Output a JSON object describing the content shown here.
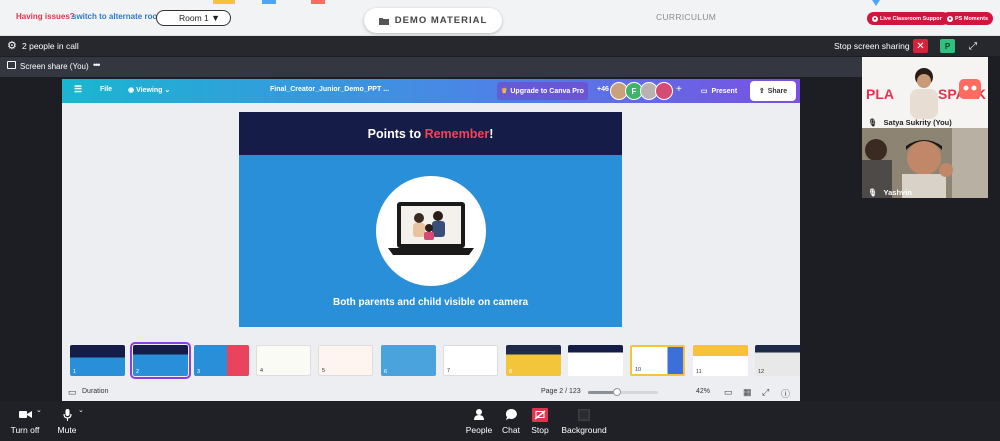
{
  "topbar": {
    "issues_text": "Having issues?",
    "alt_room_link": "switch to alternate room",
    "room_value": "Room 1",
    "demo_material_label": "DEMO MATERIAL",
    "curriculum_label": "CURRICULUM",
    "live_support_label": "Live Classroom Support",
    "ps_moments_label": "PS Moments",
    "colors": {
      "support": "#d0163f",
      "link": "#2f78d0",
      "issues": "#e0344e"
    }
  },
  "call_header": {
    "people_count": "2 people in call",
    "stop_sharing_label": "Stop screen sharing",
    "p_badge": "P"
  },
  "share_tab": {
    "label": "Screen share (You)"
  },
  "canva": {
    "file_label": "File",
    "viewing_label": "Viewing",
    "doc_title": "Final_Creator_Junior_Demo_PPT ...",
    "upgrade_label": "Upgrade to Canva Pro",
    "collab_count": "+46",
    "avatar_letter": "F",
    "present_label": "Present",
    "share_label": "Share",
    "slide": {
      "title_part1": "Points to ",
      "title_highlight": "Remember",
      "title_part2": "!",
      "caption": "Both parents and child visible on camera"
    },
    "thumbnails": [
      "1",
      "2",
      "3",
      "4",
      "5",
      "6",
      "7",
      "8",
      "9",
      "10",
      "11",
      "12"
    ],
    "footer": {
      "duration_label": "Duration",
      "page_label": "Page 2 / 123",
      "zoom_label": "42%",
      "zoom_level": 0.42
    }
  },
  "participants": [
    {
      "name": "Satya Sukrity (You)"
    },
    {
      "name": "Yashvin"
    }
  ],
  "toolbar": {
    "turn_off_label": "Turn off",
    "mute_label": "Mute",
    "people_label": "People",
    "chat_label": "Chat",
    "stop_label": "Stop",
    "background_label": "Background"
  }
}
